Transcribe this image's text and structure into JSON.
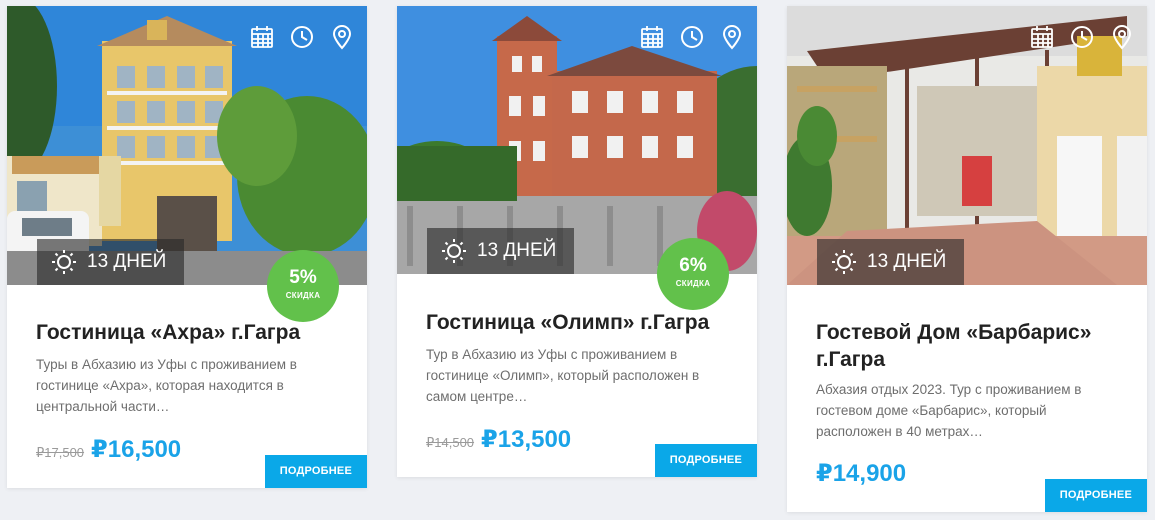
{
  "cards": [
    {
      "days": "13 ДНЕЙ",
      "discount": {
        "percent": "5%",
        "label": "СКИДКА"
      },
      "title": "Гостиница «Ахра» г.Гагра",
      "description": "Туры в Абхазию из Уфы с проживанием в гостинице «Ахра», которая находится в центральной части…",
      "old_price": "₽17,500",
      "price": "₽16,500",
      "button": "ПОДРОБНЕЕ"
    },
    {
      "days": "13 ДНЕЙ",
      "discount": {
        "percent": "6%",
        "label": "СКИДКА"
      },
      "title": "Гостиница «Олимп» г.Гагра",
      "description": "Тур в Абхазию из Уфы с проживанием в гостинице «Олимп», который расположен в самом центре…",
      "old_price": "₽14,500",
      "price": "₽13,500",
      "button": "ПОДРОБНЕЕ"
    },
    {
      "days": "13 ДНЕЙ",
      "title": "Гостевой Дом «Барбарис» г.Гагра",
      "description": "Абхазия отдых 2023. Тур с проживанием в гостевом доме «Барбарис», который расположен в 40 метрах…",
      "price": "₽14,900",
      "button": "ПОДРОБНЕЕ"
    }
  ],
  "icons": {
    "calendar": "calendar-icon",
    "clock": "clock-icon",
    "location": "location-pin-icon",
    "duration": "sun-icon"
  },
  "colors": {
    "accent": "#0aa8e8",
    "price": "#1aa3e8",
    "discount": "#62c14b"
  }
}
